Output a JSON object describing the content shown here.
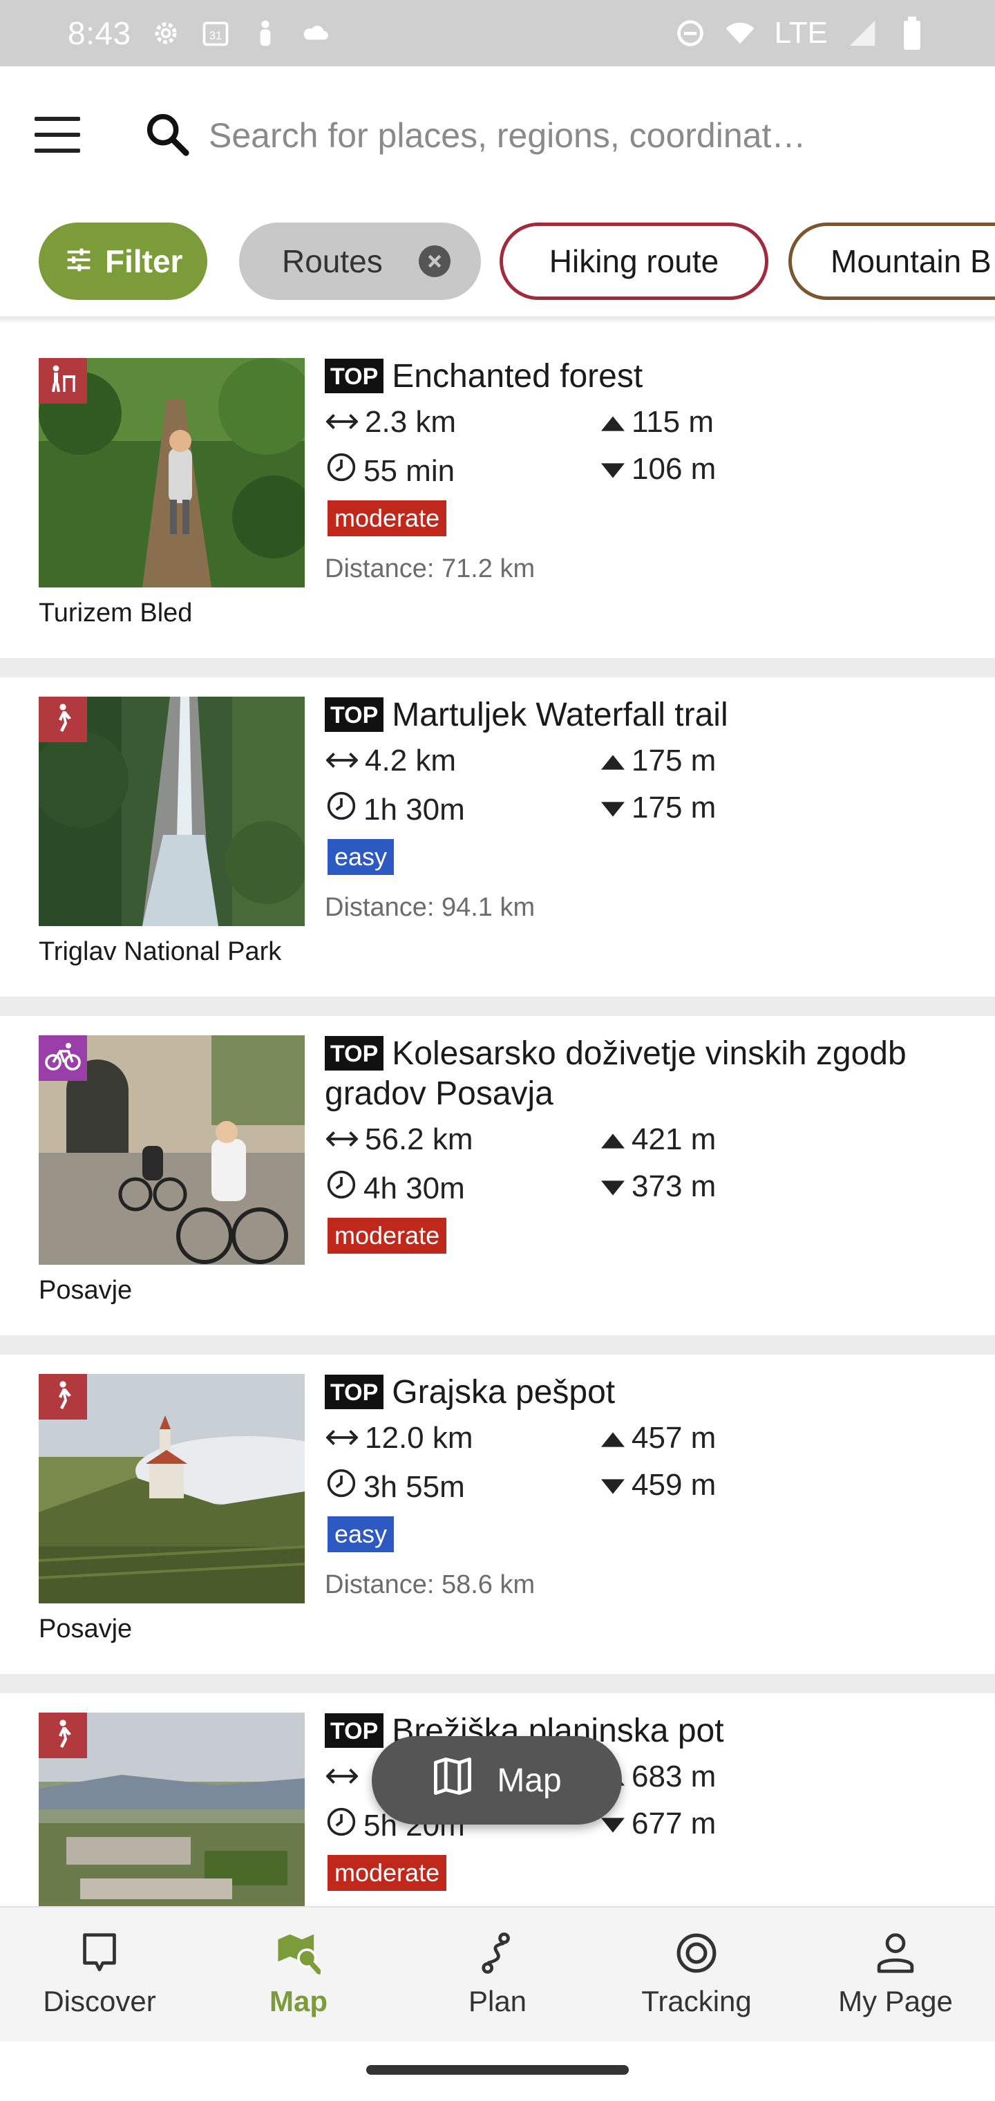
{
  "status_bar": {
    "time": "8:43",
    "calendar_day": "31",
    "network": "LTE"
  },
  "search": {
    "placeholder": "Search for places, regions, coordinat…"
  },
  "chips": {
    "filter": "Filter",
    "routes": "Routes",
    "hiking": "Hiking route",
    "mtb": "Mountain B"
  },
  "routes": [
    {
      "badge": "TOP",
      "title": "Enchanted forest",
      "length": "2.3 km",
      "duration": "55 min",
      "ascent": "115 m",
      "descent": "106 m",
      "difficulty": "moderate",
      "distance": "Distance: 71.2 km",
      "source": "Turizem Bled",
      "type_icon": "hiking-with-kids-icon",
      "badge_color": "#b23a3f"
    },
    {
      "badge": "TOP",
      "title": "Martuljek Waterfall trail",
      "length": "4.2 km",
      "duration": "1h 30m",
      "ascent": "175 m",
      "descent": "175 m",
      "difficulty": "easy",
      "distance": "Distance: 94.1 km",
      "source": "Triglav National Park",
      "type_icon": "hiking-icon",
      "badge_color": "#b23a3f"
    },
    {
      "badge": "TOP",
      "title": "Kolesarsko doživetje vinskih zgodb gradov Posavja",
      "length": "56.2 km",
      "duration": "4h 30m",
      "ascent": "421 m",
      "descent": "373 m",
      "difficulty": "moderate",
      "distance": "",
      "source": "Posavje",
      "type_icon": "bicycle-icon",
      "badge_color": "#9b3fa8"
    },
    {
      "badge": "TOP",
      "title": "Grajska pešpot",
      "length": "12.0 km",
      "duration": "3h 55m",
      "ascent": "457 m",
      "descent": "459 m",
      "difficulty": "easy",
      "distance": "Distance: 58.6 km",
      "source": "Posavje",
      "type_icon": "hiking-icon",
      "badge_color": "#b23a3f"
    },
    {
      "badge": "TOP",
      "title": "Brežiška planinska pot",
      "length": "",
      "duration": "5h 20m",
      "ascent": "683 m",
      "descent": "677 m",
      "difficulty": "moderate",
      "distance": "",
      "source": "",
      "type_icon": "hiking-icon",
      "badge_color": "#b23a3f"
    }
  ],
  "map_button": {
    "label": "Map"
  },
  "nav": {
    "discover": "Discover",
    "map": "Map",
    "plan": "Plan",
    "tracking": "Tracking",
    "mypage": "My Page"
  },
  "colors": {
    "accent_green": "#7c9c3a",
    "moderate": "#c0281c",
    "easy": "#2c59c2",
    "hiking_border": "#a12a3c",
    "mtb_border": "#7a5630"
  }
}
